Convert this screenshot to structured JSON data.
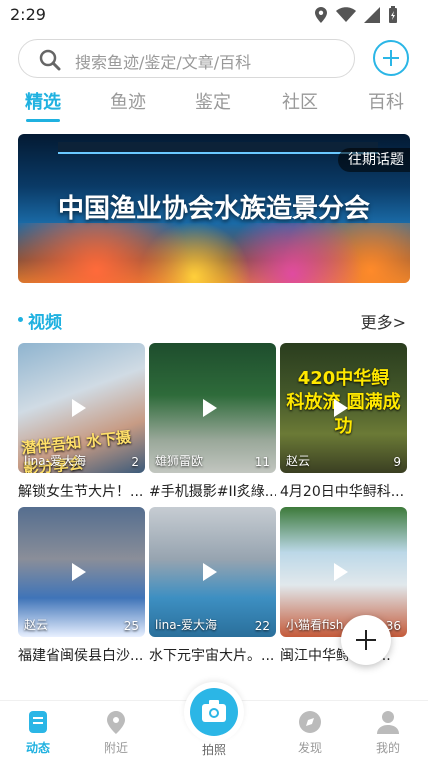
{
  "status_bar": {
    "time": "2:29"
  },
  "search": {
    "placeholder": "搜索鱼迹/鉴定/文章/百科"
  },
  "tabs": [
    {
      "label": "精选"
    },
    {
      "label": "鱼迹"
    },
    {
      "label": "鉴定"
    },
    {
      "label": "社区"
    },
    {
      "label": "百科"
    }
  ],
  "banner": {
    "title": "中国渔业协会水族造景分会",
    "tag": "往期话题"
  },
  "video_section": {
    "title": "视频",
    "more": "更多>"
  },
  "videos": [
    {
      "author": "lina-爱大海",
      "count": "2",
      "title": "解锁女生节大片！...",
      "overlay": "潜伴吾知 水下摄影分享会"
    },
    {
      "author": "雄狮雷欧",
      "count": "11",
      "title": "#手机摄影#II炙綠..."
    },
    {
      "author": "赵云",
      "count": "9",
      "title": "4月20日中华鲟科...",
      "overlay": "420中华鲟 科放流 圆满成功"
    },
    {
      "author": "赵云",
      "count": "25",
      "title": "福建省闽侯县白沙..."
    },
    {
      "author": "lina-爱大海",
      "count": "22",
      "title": "水下元宇宙大片。..."
    },
    {
      "author": "小猫看fish",
      "count": "36",
      "title": "闽江中华鲟...放..."
    }
  ],
  "bottom_nav": [
    {
      "label": "动态",
      "icon": "feed-icon",
      "active": true
    },
    {
      "label": "附近",
      "icon": "location-pin-icon"
    },
    {
      "label": "拍照",
      "icon": "camera-icon"
    },
    {
      "label": "发现",
      "icon": "compass-icon"
    },
    {
      "label": "我的",
      "icon": "person-icon"
    }
  ],
  "colors": {
    "accent": "#1fb1e0"
  }
}
